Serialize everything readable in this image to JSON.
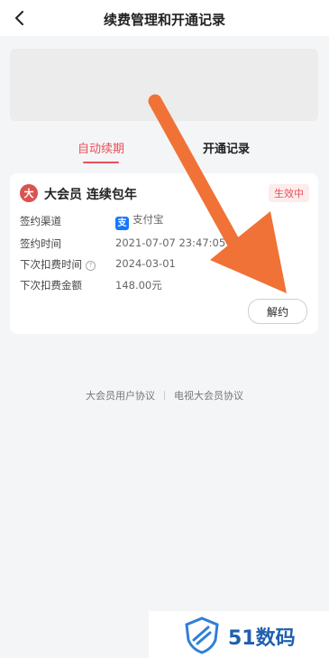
{
  "header": {
    "title": "续费管理和开通记录",
    "back_icon": "chevron-left-icon"
  },
  "tabs": [
    {
      "label": "自动续期",
      "active": true
    },
    {
      "label": "开通记录",
      "active": false
    }
  ],
  "card": {
    "icon_char": "大",
    "title": "大会员 连续包年",
    "status": "生效中",
    "rows": [
      {
        "label": "签约渠道",
        "value": "支付宝",
        "value_icon": "alipay-icon"
      },
      {
        "label": "签约时间",
        "value": "2021-07-07 23:47:05"
      },
      {
        "label": "下次扣费时间",
        "value": "2024-03-01",
        "help": true
      },
      {
        "label": "下次扣费金额",
        "value": "148.00元"
      }
    ],
    "action_label": "解约"
  },
  "footer": {
    "links": [
      "大会员用户协议",
      "电视大会员协议"
    ]
  },
  "watermark": {
    "text": "51数码"
  },
  "colors": {
    "accent": "#e8505b",
    "arrow": "#f07236",
    "alipay": "#1677ff"
  }
}
